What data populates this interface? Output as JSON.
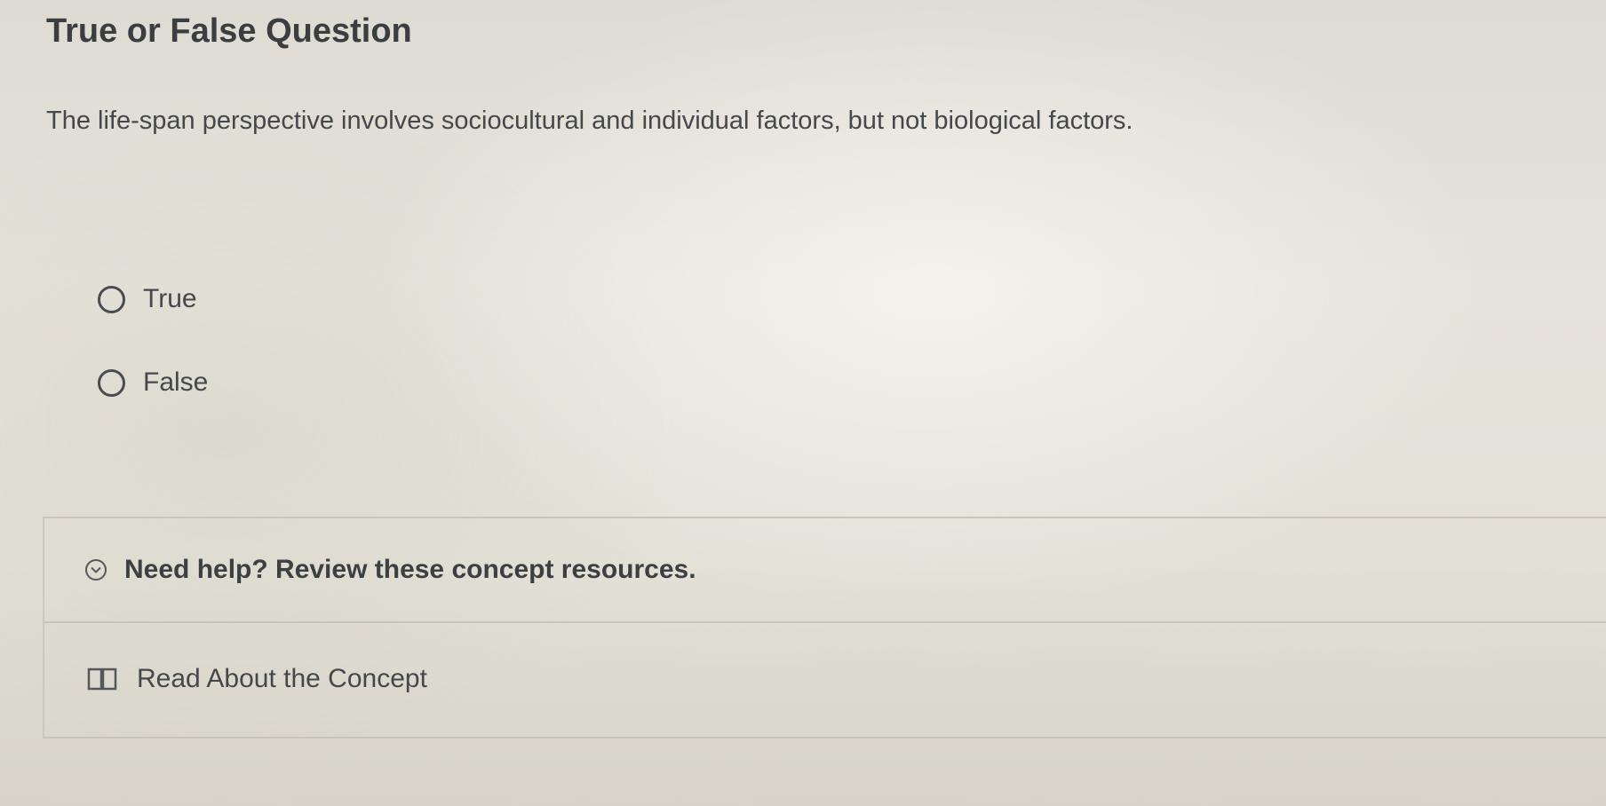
{
  "question": {
    "title": "True or False Question",
    "text": "The life-span perspective involves sociocultural and individual factors, but not biological factors."
  },
  "options": [
    {
      "label": "True",
      "selected": false
    },
    {
      "label": "False",
      "selected": false
    }
  ],
  "help": {
    "toggle_label": "Need help? Review these concept resources.",
    "toggle_icon": "chevron-down-icon",
    "resources": [
      {
        "label": "Read About the Concept",
        "icon": "book-icon"
      }
    ]
  }
}
